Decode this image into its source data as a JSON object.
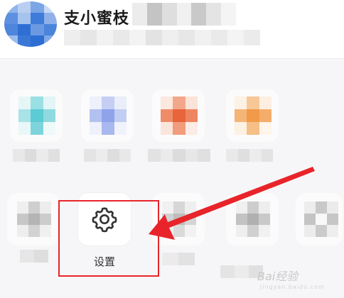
{
  "header": {
    "title": "支小蜜枝"
  },
  "settings": {
    "label": "设置",
    "icon": "gear-icon"
  },
  "annotation": {
    "color": "#e8242a"
  },
  "watermark": {
    "text": "Bai经验",
    "sub": "jingyan.baidu.com"
  }
}
